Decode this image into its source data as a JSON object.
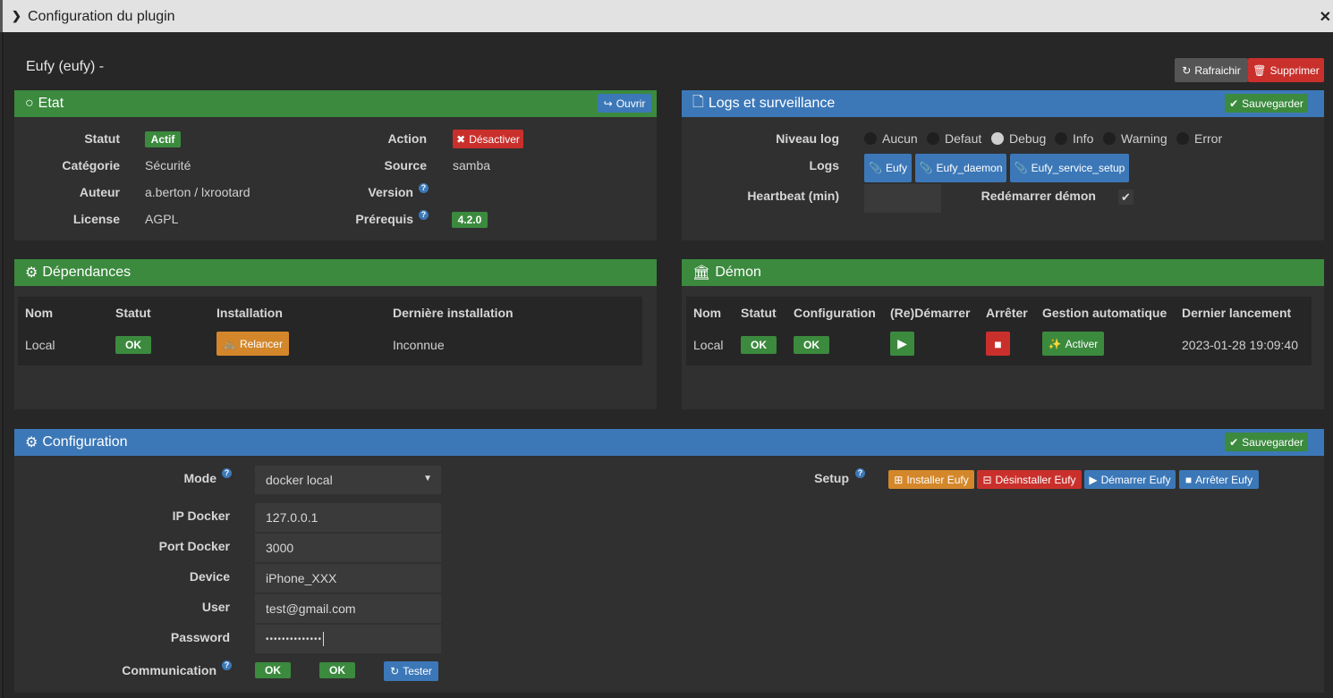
{
  "modal": {
    "title": "Configuration du plugin"
  },
  "plugin": {
    "title": "Eufy (eufy) -"
  },
  "toolbar": {
    "refresh": "Rafraichir",
    "delete": "Supprimer"
  },
  "etat": {
    "title": "Etat",
    "open": "Ouvrir",
    "labels": {
      "statut": "Statut",
      "categorie": "Catégorie",
      "auteur": "Auteur",
      "license": "License",
      "action": "Action",
      "source": "Source",
      "version": "Version",
      "prerequis": "Prérequis"
    },
    "values": {
      "statut": "Actif",
      "categorie": "Sécurité",
      "auteur": "a.berton / lxrootard",
      "license": "AGPL",
      "action": "Désactiver",
      "source": "samba",
      "version": "",
      "prerequis": "4.2.0"
    }
  },
  "logs": {
    "title": "Logs et surveillance",
    "save": "Sauvegarder",
    "niveau_label": "Niveau log",
    "levels": [
      "Aucun",
      "Defaut",
      "Debug",
      "Info",
      "Warning",
      "Error"
    ],
    "selected_level": "Debug",
    "logs_label": "Logs",
    "log_buttons": [
      "Eufy",
      "Eufy_daemon",
      "Eufy_service_setup"
    ],
    "heartbeat_label": "Heartbeat (min)",
    "heartbeat_value": "",
    "restart_label": "Redémarrer démon",
    "restart_checked": true
  },
  "dependances": {
    "title": "Dépendances",
    "headers": [
      "Nom",
      "Statut",
      "Installation",
      "Dernière installation"
    ],
    "row": {
      "nom": "Local",
      "statut": "OK",
      "installation": "Relancer",
      "derniere": "Inconnue"
    }
  },
  "demon": {
    "title": "Démon",
    "headers": [
      "Nom",
      "Statut",
      "Configuration",
      "(Re)Démarrer",
      "Arrêter",
      "Gestion automatique",
      "Dernier lancement"
    ],
    "row": {
      "nom": "Local",
      "statut": "OK",
      "configuration": "OK",
      "gestion": "Activer",
      "dernier": "2023-01-28 19:09:40"
    }
  },
  "configuration": {
    "title": "Configuration",
    "save": "Sauvegarder",
    "mode_label": "Mode",
    "mode_value": "docker local",
    "ip_label": "IP Docker",
    "ip_value": "127.0.0.1",
    "port_label": "Port Docker",
    "port_value": "3000",
    "device_label": "Device",
    "device_value": "iPhone_XXX",
    "user_label": "User",
    "user_value": "test@gmail.com",
    "password_label": "Password",
    "password_value": "••••••••••••••",
    "comm_label": "Communication",
    "comm_1": "OK",
    "comm_2": "OK",
    "test": "Tester",
    "setup_label": "Setup",
    "setup_buttons": [
      "Installer Eufy",
      "Désinstaller Eufy",
      "Démarrer Eufy",
      "Arrêter Eufy"
    ]
  },
  "colors": {
    "green": "#3b8a3e",
    "blue": "#3c78b8",
    "red": "#c9302c",
    "orange": "#d3872a",
    "gray": "#4a4a4a"
  }
}
